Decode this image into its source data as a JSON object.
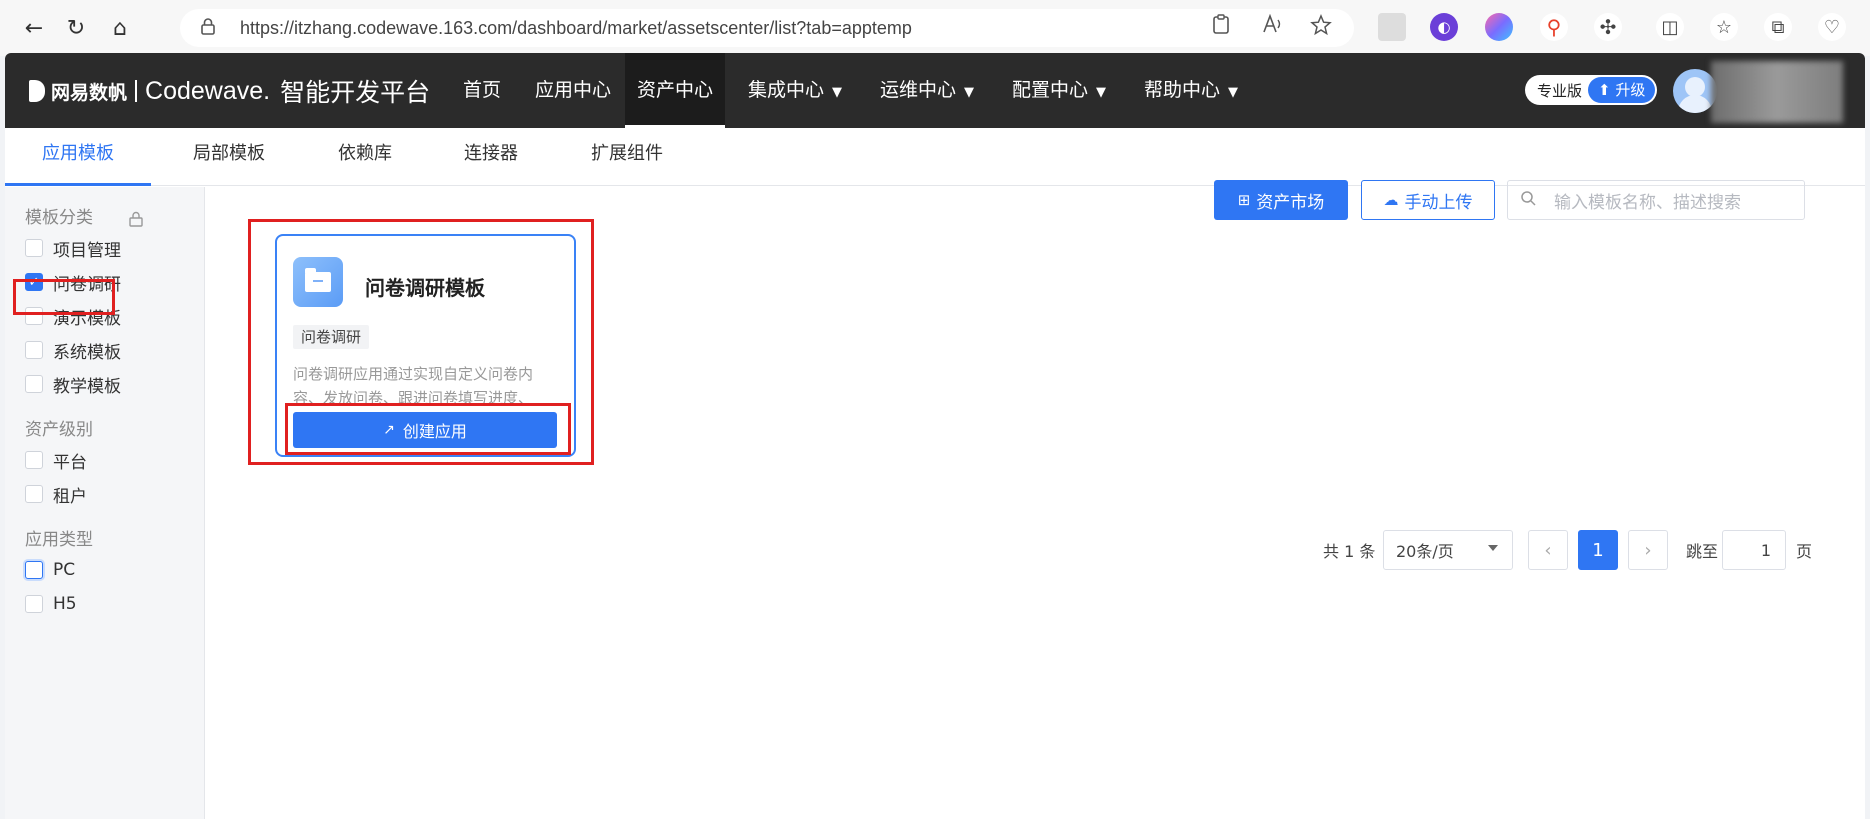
{
  "browser": {
    "url": "https://itzhang.codewave.163.com/dashboard/market/assetscenter/list?tab=apptemp",
    "back_icon": "←",
    "refresh_icon": "↻",
    "home_icon": "⌂",
    "lock_icon": "🔒"
  },
  "header": {
    "brand_netease": "网易数帆",
    "brand_codewave": "Codewave.",
    "brand_platform": "智能开发平台",
    "menu": [
      "首页",
      "应用中心",
      "资产中心",
      "集成中心",
      "运维中心",
      "配置中心",
      "帮助中心"
    ],
    "active_menu": "资产中心",
    "edition_label": "专业版",
    "upgrade_label": "升级"
  },
  "subtabs": [
    "应用模板",
    "局部模板",
    "依赖库",
    "连接器",
    "扩展组件"
  ],
  "sidebar": {
    "category_title": "模板分类",
    "categories": [
      "项目管理",
      "问卷调研",
      "演示模板",
      "系统模板",
      "教学模板"
    ],
    "level_title": "资产级别",
    "levels": [
      "平台",
      "租户"
    ],
    "type_title": "应用类型",
    "types": [
      "PC",
      "H5"
    ]
  },
  "toolbar": {
    "market_label": "资产市场",
    "upload_label": "手动上传",
    "search_placeholder": "输入模板名称、描述搜索"
  },
  "card": {
    "title": "问卷调研模板",
    "tag": "问卷调研",
    "description": "问卷调研应用通过实现自定义问卷内容、发放问卷、跟进问卷填写进度、统…",
    "create_label": "创建应用"
  },
  "pagination": {
    "total_text": "共 1 条",
    "page_size": "20条/页",
    "current_page": "1",
    "prev": "‹",
    "next": "›",
    "jump_label": "跳至",
    "jump_value": "1",
    "page_suffix": "页"
  },
  "colors": {
    "accent": "#2f76f3",
    "highlight": "#e02020",
    "nav_bg": "#2b2b2b"
  }
}
